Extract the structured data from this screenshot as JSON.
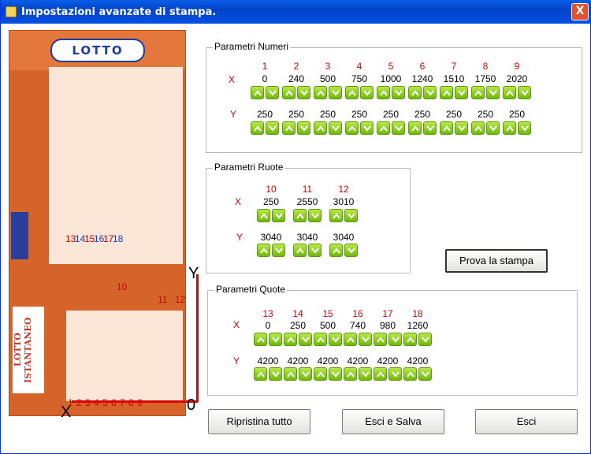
{
  "window": {
    "title": "Impostazioni avanzate di stampa.",
    "close": "X"
  },
  "ticket": {
    "logo": "LOTTO",
    "brand_text": "LOTTO ISTANTANEO",
    "labels_top": [
      "13",
      "14",
      "15",
      "16",
      "17",
      "18"
    ],
    "label_10": "10",
    "label_11": "11",
    "label_12": "12",
    "labels_bottom": [
      "1",
      "2",
      "3",
      "4",
      "5",
      "6",
      "7",
      "8",
      "9"
    ],
    "axis_x": "X",
    "axis_y": "Y",
    "origin": "0"
  },
  "numeri": {
    "title": "Parametri Numeri",
    "indices": [
      "1",
      "2",
      "3",
      "4",
      "5",
      "6",
      "7",
      "8",
      "9"
    ],
    "x_label": "X",
    "y_label": "Y",
    "x": [
      "0",
      "240",
      "500",
      "750",
      "1000",
      "1240",
      "1510",
      "1750",
      "2020"
    ],
    "y": [
      "250",
      "250",
      "250",
      "250",
      "250",
      "250",
      "250",
      "250",
      "250"
    ]
  },
  "ruote": {
    "title": "Parametri Ruote",
    "indices": [
      "10",
      "11",
      "12"
    ],
    "x_label": "X",
    "y_label": "Y",
    "x": [
      "250",
      "2550",
      "3010"
    ],
    "y": [
      "3040",
      "3040",
      "3040"
    ]
  },
  "quote": {
    "title": "Parametri Quote",
    "indices": [
      "13",
      "14",
      "15",
      "16",
      "17",
      "18"
    ],
    "x_label": "X",
    "y_label": "Y",
    "x": [
      "0",
      "250",
      "500",
      "740",
      "980",
      "1260"
    ],
    "y": [
      "4200",
      "4200",
      "4200",
      "4200",
      "4200",
      "4200"
    ]
  },
  "buttons": {
    "prova": "Prova la stampa",
    "ripristina": "Ripristina tutto",
    "esci_salva": "Esci e Salva",
    "esci": "Esci"
  },
  "colors": {
    "index": "#cc0000",
    "spinner": "#8fd11e",
    "title_bar": "#0a5ee6"
  }
}
